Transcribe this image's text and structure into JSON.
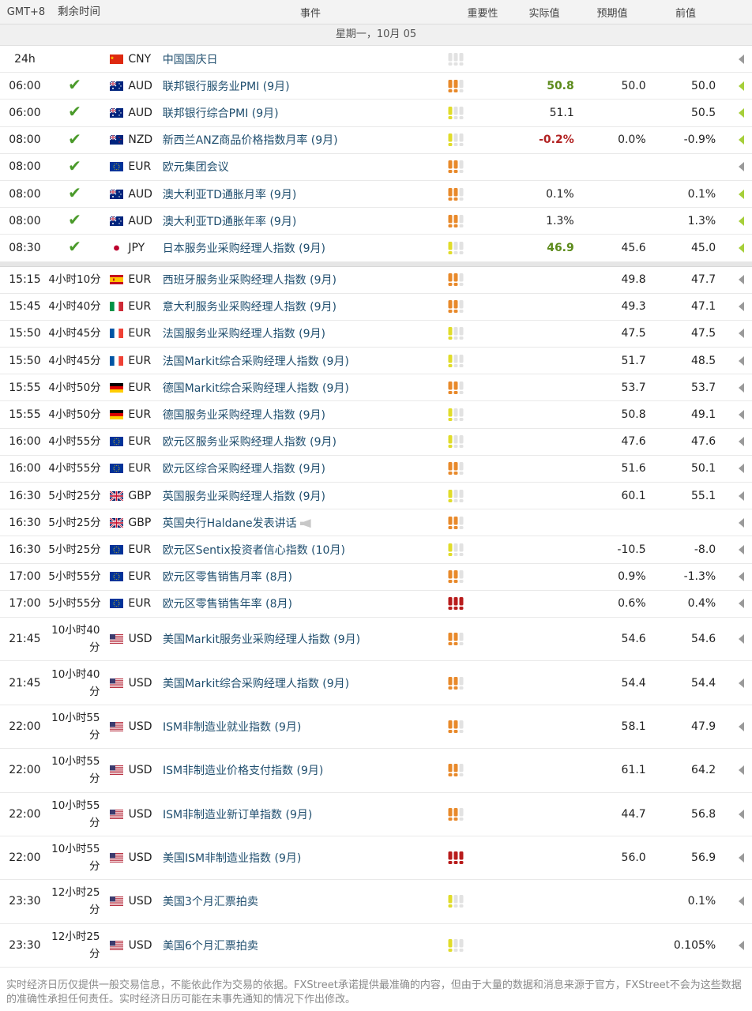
{
  "header": {
    "tz": "GMT+8",
    "remaining": "剩余时间",
    "event": "事件",
    "importance": "重要性",
    "actual": "实际值",
    "consensus": "预期值",
    "previous": "前值"
  },
  "date_band": "星期一，10月 05",
  "colors": {
    "low": "#e0dc2a",
    "medium": "#e8892a",
    "high": "#b81c1c",
    "off": "#e2e2e2",
    "check": "#4a9a2a"
  },
  "past_rows": [
    {
      "time": "24h",
      "remaining": "",
      "done": false,
      "flag": "CN",
      "currency": "CNY",
      "event": "中国国庆日",
      "imp": 0,
      "actual": "",
      "actual_style": "",
      "consensus": "",
      "previous": "",
      "arrow": "gray"
    },
    {
      "time": "06:00",
      "remaining": "",
      "done": true,
      "flag": "AU",
      "currency": "AUD",
      "event": "联邦银行服务业PMI (9月)",
      "imp": 2,
      "actual": "50.8",
      "actual_style": "green",
      "consensus": "50.0",
      "previous": "50.0",
      "arrow": "green"
    },
    {
      "time": "06:00",
      "remaining": "",
      "done": true,
      "flag": "AU",
      "currency": "AUD",
      "event": "联邦银行综合PMI (9月)",
      "imp": 1,
      "actual": "51.1",
      "actual_style": "",
      "consensus": "",
      "previous": "50.5",
      "arrow": "green"
    },
    {
      "time": "08:00",
      "remaining": "",
      "done": true,
      "flag": "NZ",
      "currency": "NZD",
      "event": "新西兰ANZ商品价格指数月率 (9月)",
      "imp": 1,
      "actual": "-0.2%",
      "actual_style": "red",
      "consensus": "0.0%",
      "previous": "-0.9%",
      "arrow": "green"
    },
    {
      "time": "08:00",
      "remaining": "",
      "done": true,
      "flag": "EU",
      "currency": "EUR",
      "event": "欧元集团会议",
      "imp": 2,
      "actual": "",
      "actual_style": "",
      "consensus": "",
      "previous": "",
      "arrow": "gray"
    },
    {
      "time": "08:00",
      "remaining": "",
      "done": true,
      "flag": "AU",
      "currency": "AUD",
      "event": "澳大利亚TD通胀月率 (9月)",
      "imp": 2,
      "actual": "0.1%",
      "actual_style": "",
      "consensus": "",
      "previous": "0.1%",
      "arrow": "green"
    },
    {
      "time": "08:00",
      "remaining": "",
      "done": true,
      "flag": "AU",
      "currency": "AUD",
      "event": "澳大利亚TD通胀年率 (9月)",
      "imp": 2,
      "actual": "1.3%",
      "actual_style": "",
      "consensus": "",
      "previous": "1.3%",
      "arrow": "green"
    },
    {
      "time": "08:30",
      "remaining": "",
      "done": true,
      "flag": "JP",
      "currency": "JPY",
      "event": "日本服务业采购经理人指数 (9月)",
      "imp": 1,
      "actual": "46.9",
      "actual_style": "green",
      "consensus": "45.6",
      "previous": "45.0",
      "arrow": "green"
    }
  ],
  "future_rows": [
    {
      "time": "15:15",
      "remaining": "4小时10分",
      "flag": "ES",
      "currency": "EUR",
      "event": "西班牙服务业采购经理人指数 (9月)",
      "imp": 2,
      "consensus": "49.8",
      "previous": "47.7",
      "speech": false
    },
    {
      "time": "15:45",
      "remaining": "4小时40分",
      "flag": "IT",
      "currency": "EUR",
      "event": "意大利服务业采购经理人指数 (9月)",
      "imp": 2,
      "consensus": "49.3",
      "previous": "47.1",
      "speech": false
    },
    {
      "time": "15:50",
      "remaining": "4小时45分",
      "flag": "FR",
      "currency": "EUR",
      "event": "法国服务业采购经理人指数 (9月)",
      "imp": 1,
      "consensus": "47.5",
      "previous": "47.5",
      "speech": false
    },
    {
      "time": "15:50",
      "remaining": "4小时45分",
      "flag": "FR",
      "currency": "EUR",
      "event": "法国Markit综合采购经理人指数 (9月)",
      "imp": 1,
      "consensus": "51.7",
      "previous": "48.5",
      "speech": false
    },
    {
      "time": "15:55",
      "remaining": "4小时50分",
      "flag": "DE",
      "currency": "EUR",
      "event": "德国Markit综合采购经理人指数 (9月)",
      "imp": 2,
      "consensus": "53.7",
      "previous": "53.7",
      "speech": false
    },
    {
      "time": "15:55",
      "remaining": "4小时50分",
      "flag": "DE",
      "currency": "EUR",
      "event": "德国服务业采购经理人指数 (9月)",
      "imp": 1,
      "consensus": "50.8",
      "previous": "49.1",
      "speech": false
    },
    {
      "time": "16:00",
      "remaining": "4小时55分",
      "flag": "EU",
      "currency": "EUR",
      "event": "欧元区服务业采购经理人指数 (9月)",
      "imp": 1,
      "consensus": "47.6",
      "previous": "47.6",
      "speech": false
    },
    {
      "time": "16:00",
      "remaining": "4小时55分",
      "flag": "EU",
      "currency": "EUR",
      "event": "欧元区综合采购经理人指数 (9月)",
      "imp": 2,
      "consensus": "51.6",
      "previous": "50.1",
      "speech": false
    },
    {
      "time": "16:30",
      "remaining": "5小时25分",
      "flag": "GB",
      "currency": "GBP",
      "event": "英国服务业采购经理人指数 (9月)",
      "imp": 1,
      "consensus": "60.1",
      "previous": "55.1",
      "speech": false
    },
    {
      "time": "16:30",
      "remaining": "5小时25分",
      "flag": "GB",
      "currency": "GBP",
      "event": "英国央行Haldane发表讲话",
      "imp": 2,
      "consensus": "",
      "previous": "",
      "speech": true
    },
    {
      "time": "16:30",
      "remaining": "5小时25分",
      "flag": "EU",
      "currency": "EUR",
      "event": "欧元区Sentix投资者信心指数 (10月)",
      "imp": 1,
      "consensus": "-10.5",
      "previous": "-8.0",
      "speech": false
    },
    {
      "time": "17:00",
      "remaining": "5小时55分",
      "flag": "EU",
      "currency": "EUR",
      "event": "欧元区零售销售月率 (8月)",
      "imp": 2,
      "consensus": "0.9%",
      "previous": "-1.3%",
      "speech": false
    },
    {
      "time": "17:00",
      "remaining": "5小时55分",
      "flag": "EU",
      "currency": "EUR",
      "event": "欧元区零售销售年率 (8月)",
      "imp": 3,
      "consensus": "0.6%",
      "previous": "0.4%",
      "speech": false
    }
  ],
  "future_rows_tall": [
    {
      "time": "21:45",
      "remaining_1": "10小时40",
      "remaining_2": "分",
      "flag": "US",
      "currency": "USD",
      "event": "美国Markit服务业采购经理人指数 (9月)",
      "imp": 2,
      "consensus": "54.6",
      "previous": "54.6"
    },
    {
      "time": "21:45",
      "remaining_1": "10小时40",
      "remaining_2": "分",
      "flag": "US",
      "currency": "USD",
      "event": "美国Markit综合采购经理人指数 (9月)",
      "imp": 2,
      "consensus": "54.4",
      "previous": "54.4"
    },
    {
      "time": "22:00",
      "remaining_1": "10小时55",
      "remaining_2": "分",
      "flag": "US",
      "currency": "USD",
      "event": "ISM非制造业就业指数 (9月)",
      "imp": 2,
      "consensus": "58.1",
      "previous": "47.9"
    },
    {
      "time": "22:00",
      "remaining_1": "10小时55",
      "remaining_2": "分",
      "flag": "US",
      "currency": "USD",
      "event": "ISM非制造业价格支付指数 (9月)",
      "imp": 2,
      "consensus": "61.1",
      "previous": "64.2"
    },
    {
      "time": "22:00",
      "remaining_1": "10小时55",
      "remaining_2": "分",
      "flag": "US",
      "currency": "USD",
      "event": "ISM非制造业新订单指数 (9月)",
      "imp": 2,
      "consensus": "44.7",
      "previous": "56.8"
    },
    {
      "time": "22:00",
      "remaining_1": "10小时55",
      "remaining_2": "分",
      "flag": "US",
      "currency": "USD",
      "event": "美国ISM非制造业指数 (9月)",
      "imp": 3,
      "consensus": "56.0",
      "previous": "56.9"
    },
    {
      "time": "23:30",
      "remaining_1": "12小时25",
      "remaining_2": "分",
      "flag": "US",
      "currency": "USD",
      "event": "美国3个月汇票拍卖",
      "imp": 1,
      "consensus": "",
      "previous": "0.1%"
    },
    {
      "time": "23:30",
      "remaining_1": "12小时25",
      "remaining_2": "分",
      "flag": "US",
      "currency": "USD",
      "event": "美国6个月汇票拍卖",
      "imp": 1,
      "consensus": "",
      "previous": "0.105%"
    }
  ],
  "footer": "实时经济日历仅提供一般交易信息，不能依此作为交易的依据。FXStreet承诺提供最准确的内容，但由于大量的数据和消息来源于官方，FXStreet不会为这些数据的准确性承担任何责任。实时经济日历可能在未事先通知的情况下作出修改。"
}
